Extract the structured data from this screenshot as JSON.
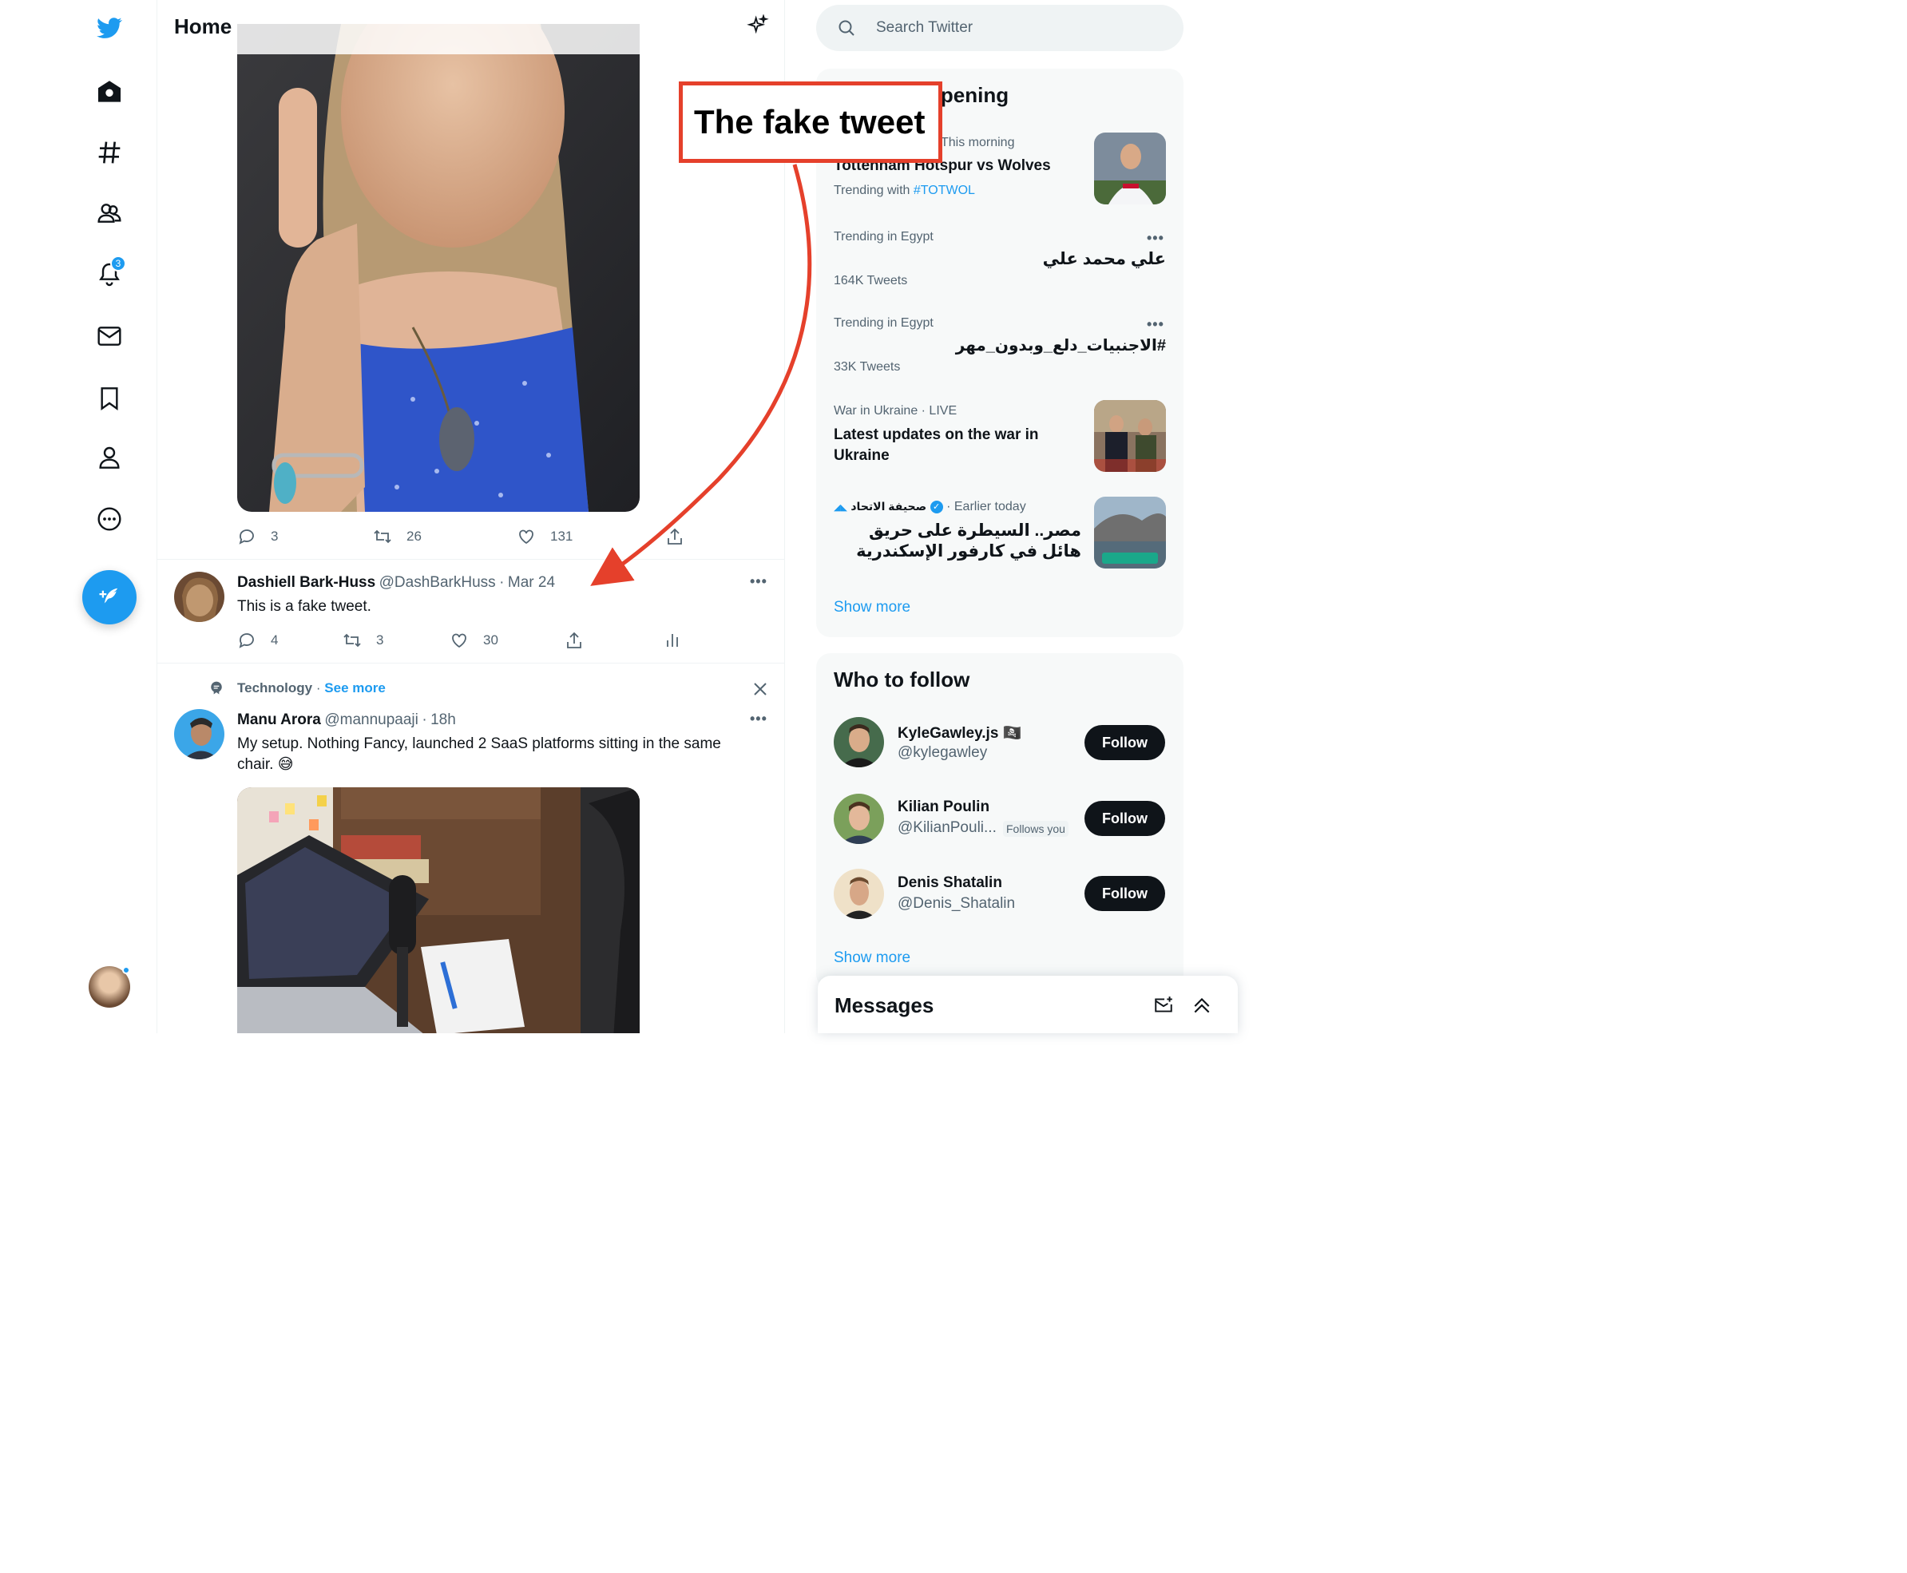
{
  "nav": {
    "notifications_badge": "3",
    "icons": [
      "twitter-logo-icon",
      "home-icon",
      "explore-hashtag-icon",
      "communities-icon",
      "notifications-bell-icon",
      "messages-envelope-icon",
      "bookmark-icon",
      "profile-icon",
      "more-icon"
    ]
  },
  "header": {
    "title": "Home"
  },
  "tweet1": {
    "replies": "3",
    "retweets": "26",
    "likes": "131"
  },
  "tweet2": {
    "name": "Dashiell Bark-Huss",
    "handle": "@DashBarkHuss",
    "time": "Mar 24",
    "text": "This is a fake tweet.",
    "replies": "4",
    "retweets": "3",
    "likes": "30"
  },
  "tweet3": {
    "topic": "Technology",
    "see_more": "See more",
    "name": "Manu Arora",
    "handle": "@mannupaaji",
    "time": "18h",
    "text": "My setup. Nothing Fancy, launched 2 SaaS platforms sitting in the same chair. 😅"
  },
  "search": {
    "placeholder": "Search Twitter"
  },
  "happening": {
    "title_visible": "ppening",
    "items": [
      {
        "meta": "This morning",
        "title": "Tottenham Hotspur vs Wolves",
        "trending_with": "Trending with",
        "tag": "#TOTWOL"
      },
      {
        "meta": "Trending in Egypt",
        "title": "علي محمد علي",
        "count": "164K Tweets"
      },
      {
        "meta": "Trending in Egypt",
        "title": "#الاجنبيات_دلع_وبدون_مهر",
        "count": "33K Tweets"
      },
      {
        "meta": "War in Ukraine · LIVE",
        "title": "Latest updates on the war in Ukraine"
      },
      {
        "source": "صحيفة الاتحاد",
        "meta": "· Earlier today",
        "title": "مصر.. السيطرة على حريق هائل في كارفور الإسكندرية"
      }
    ],
    "show_more": "Show more"
  },
  "who_to_follow": {
    "title": "Who to follow",
    "users": [
      {
        "name": "KyleGawley.js 🏴‍☠️",
        "handle": "@kylegawley",
        "button": "Follow"
      },
      {
        "name": "Kilian Poulin",
        "handle": "@KilianPouli...",
        "follows_you": "Follows you",
        "button": "Follow"
      },
      {
        "name": "Denis Shatalin",
        "handle": "@Denis_Shatalin",
        "button": "Follow"
      }
    ],
    "show_more": "Show more"
  },
  "messages": {
    "title": "Messages"
  },
  "annotation": {
    "label": "The fake tweet",
    "color": "#e5402b"
  },
  "colors": {
    "accent": "#1d9bf0",
    "text": "#0f1419",
    "muted": "#536471"
  }
}
